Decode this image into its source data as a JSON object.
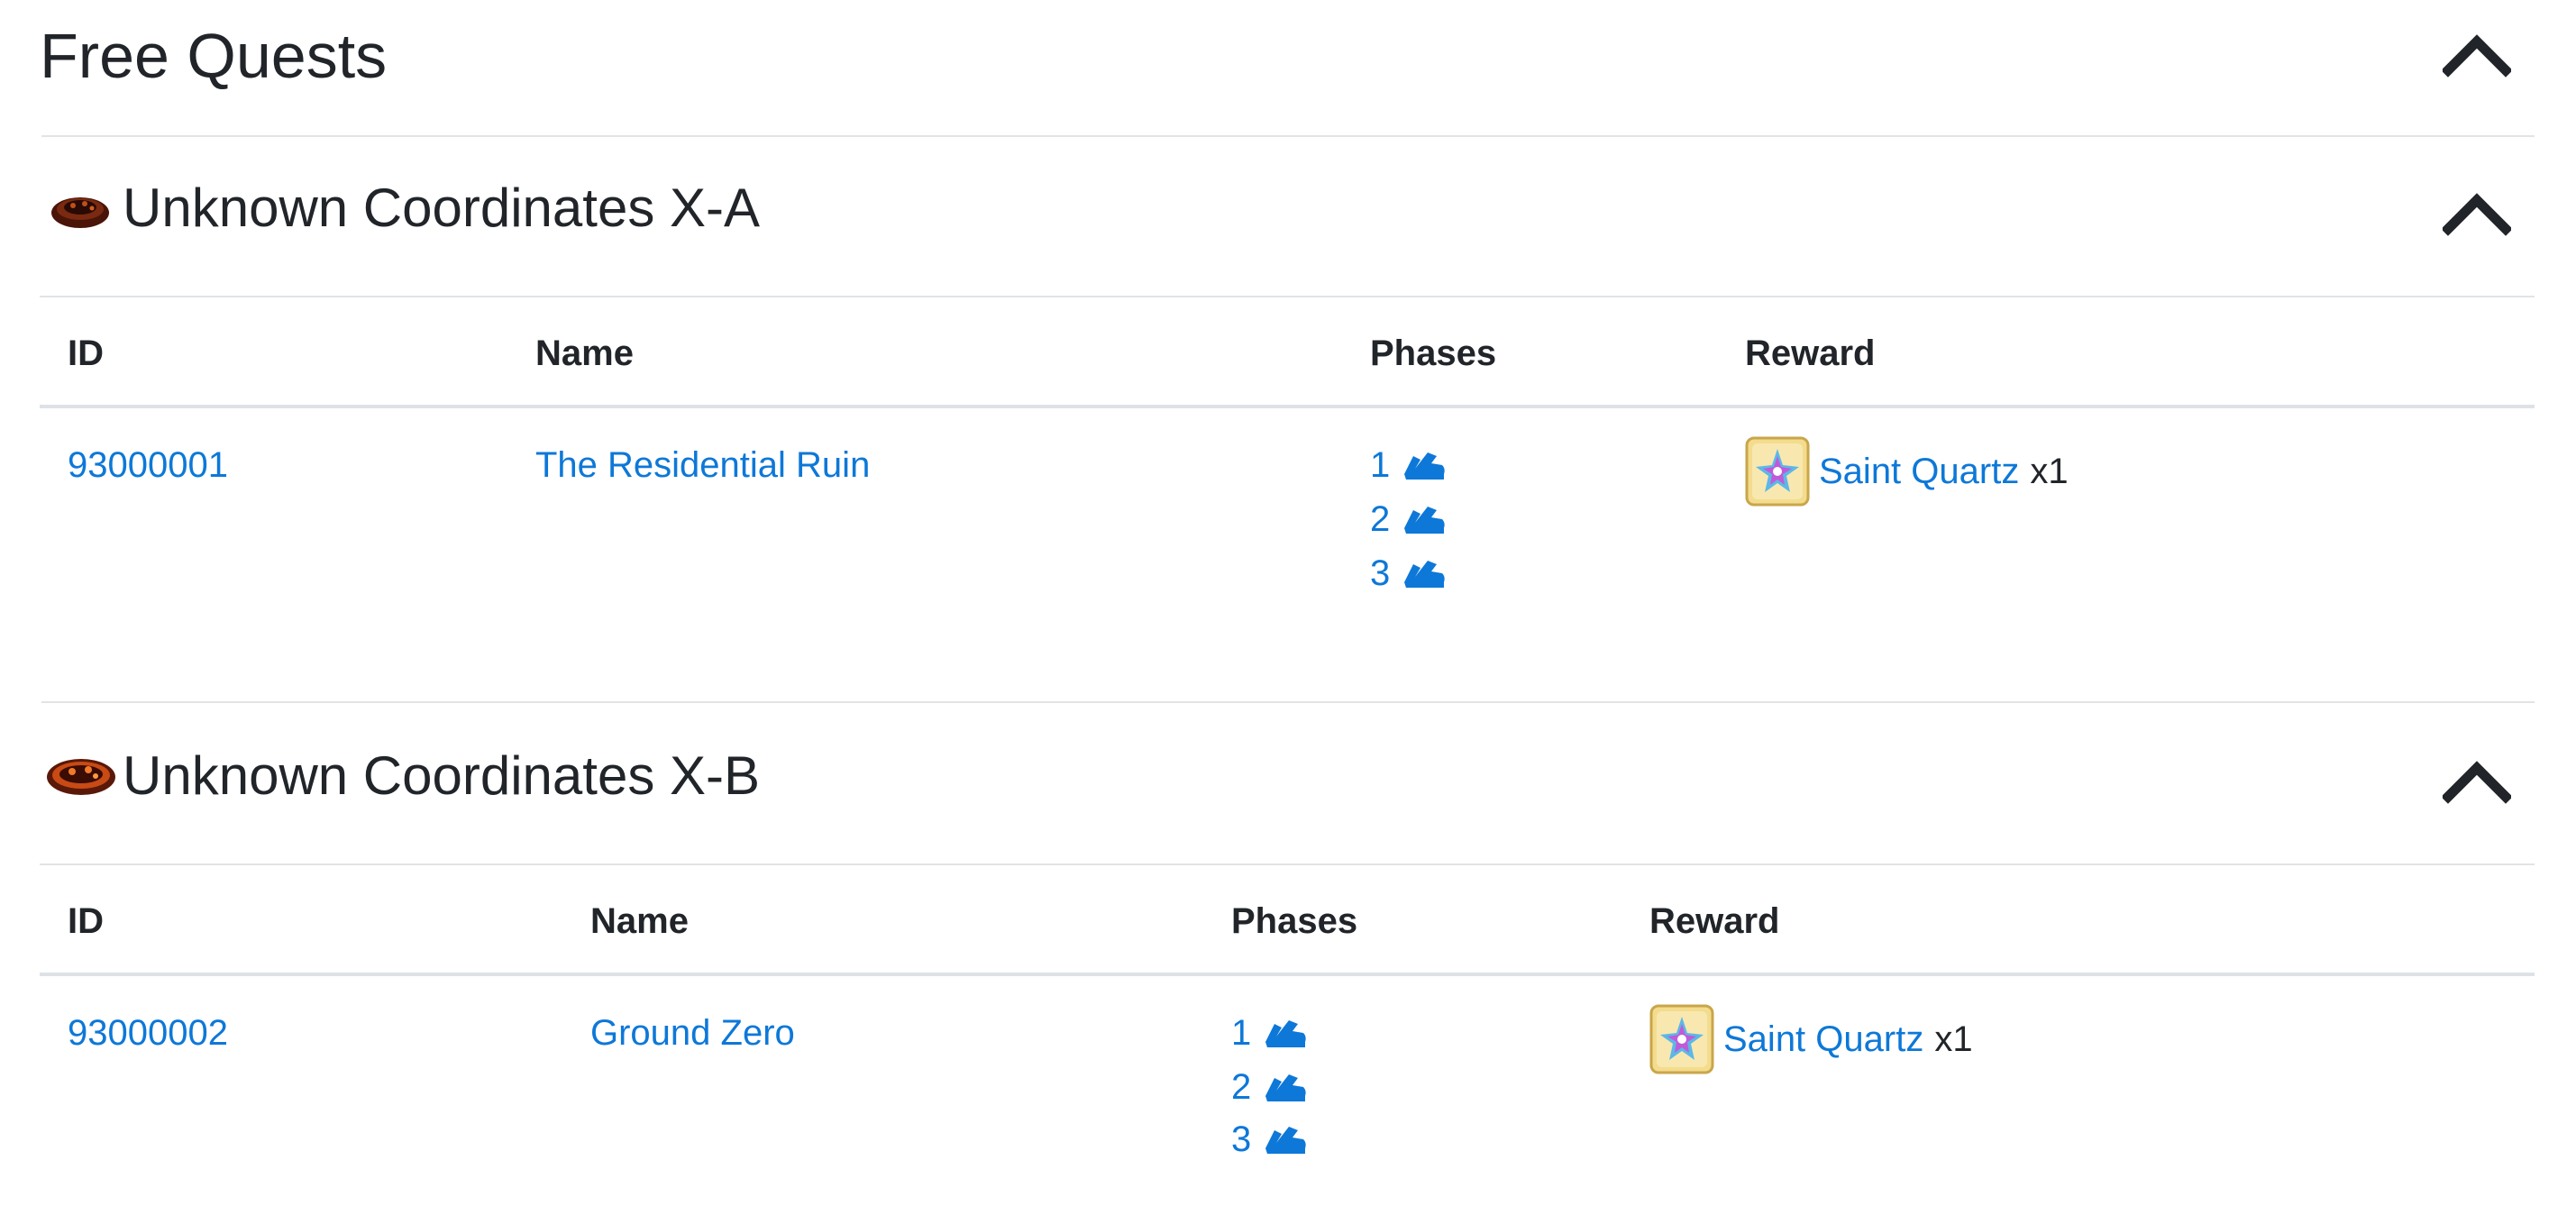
{
  "page": {
    "title": "Free Quests"
  },
  "wars": [
    {
      "title": "Unknown Coordinates X-A",
      "columns": [
        "ID",
        "Name",
        "Phases",
        "Reward"
      ],
      "quest": {
        "id": "93000001",
        "name": "The Residential Ruin",
        "phases": [
          "1",
          "2",
          "3"
        ],
        "reward": {
          "name": "Saint Quartz",
          "quantity": "x1"
        }
      }
    },
    {
      "title": "Unknown Coordinates X-B",
      "columns": [
        "ID",
        "Name",
        "Phases",
        "Reward"
      ],
      "quest": {
        "id": "93000002",
        "name": "Ground Zero",
        "phases": [
          "1",
          "2",
          "3"
        ],
        "reward": {
          "name": "Saint Quartz",
          "quantity": "x1"
        }
      }
    }
  ],
  "icons": {
    "collapse": "chevron-up-icon",
    "war": "crater-icon",
    "phase": "boot-icon",
    "reward": "saint-quartz-icon"
  },
  "colors": {
    "link": "#0d78d8",
    "text": "#212529",
    "divider": "#e2e3e5"
  }
}
